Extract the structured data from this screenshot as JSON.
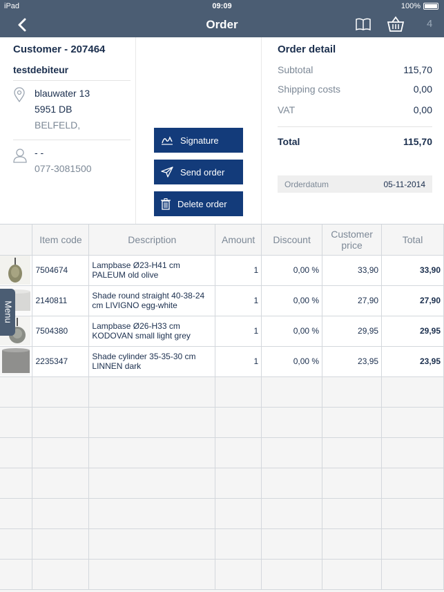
{
  "status": {
    "device": "iPad",
    "time": "09:09",
    "battery": "100%"
  },
  "nav": {
    "title": "Order",
    "basket_count": "4"
  },
  "customer": {
    "title": "Customer - 207464",
    "name": "testdebiteur",
    "street": "blauwater 13",
    "postal": "5951 DB",
    "city": "BELFELD,",
    "contact": "- -",
    "phone": "077-3081500"
  },
  "actions": {
    "signature": "Signature",
    "send": "Send order",
    "delete": "Delete order"
  },
  "order_detail": {
    "title": "Order detail",
    "subtotal_label": "Subtotal",
    "subtotal": "115,70",
    "shipping_label": "Shipping costs",
    "shipping": "0,00",
    "vat_label": "VAT",
    "vat": "0,00",
    "total_label": "Total",
    "total": "115,70",
    "date_label": "Orderdatum",
    "date": "05-11-2014"
  },
  "table": {
    "headers": {
      "code": "Item code",
      "desc": "Description",
      "amount": "Amount",
      "discount": "Discount",
      "price": "Customer price",
      "total": "Total"
    },
    "rows": [
      {
        "code": "7504674",
        "desc": "Lampbase Ø23-H41 cm PALEUM old olive",
        "amount": "1",
        "discount": "0,00 %",
        "price": "33,90",
        "total": "33,90"
      },
      {
        "code": "2140811",
        "desc": "Shade round straight 40-38-24 cm LIVIGNO egg-white",
        "amount": "1",
        "discount": "0,00 %",
        "price": "27,90",
        "total": "27,90"
      },
      {
        "code": "7504380",
        "desc": "Lampbase Ø26-H33 cm KODOVAN small light grey",
        "amount": "1",
        "discount": "0,00 %",
        "price": "29,95",
        "total": "29,95"
      },
      {
        "code": "2235347",
        "desc": "Shade cylinder 35-35-30 cm LINNEN dark",
        "amount": "1",
        "discount": "0,00 %",
        "price": "23,95",
        "total": "23,95"
      }
    ]
  },
  "menu": {
    "label": "Menu"
  }
}
